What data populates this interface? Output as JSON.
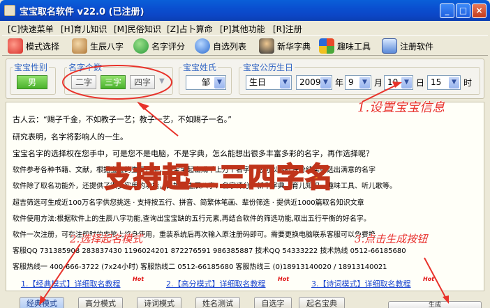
{
  "window": {
    "title": "宝宝取名软件 v22.0 (已注册)",
    "btn_min": "_",
    "btn_max": "□",
    "btn_close": "×"
  },
  "menu": [
    "[C]快速菜单",
    "[H]育儿知识",
    "[M]民俗知识",
    "[Z]占卜算命",
    "[P]其他功能",
    "[R]注册"
  ],
  "toolbar": [
    {
      "label": "模式选择",
      "icon": "heart-icon",
      "color": "#e8423a"
    },
    {
      "label": "生辰八字",
      "icon": "people-icon",
      "color": "#c89048"
    },
    {
      "label": "名字评分",
      "icon": "arrow-icon",
      "color": "#3aa84a"
    },
    {
      "label": "自选列表",
      "icon": "globe-icon",
      "color": "#3a7ad8"
    },
    {
      "label": "新华字典",
      "icon": "scholar-icon",
      "color": "#3a3a3a"
    },
    {
      "label": "趣味工具",
      "icon": "windows-icon",
      "color": "#e8a020"
    },
    {
      "label": "注册软件",
      "icon": "monitor-icon",
      "color": "#5a8ad8"
    }
  ],
  "options": {
    "gender_label": "宝宝性别",
    "gender_value": "男",
    "count_label": "名字个数",
    "count_options": [
      "二字",
      "三字",
      "四字"
    ],
    "count_selected": "三字",
    "surname_label": "宝宝姓氏",
    "surname_value": "邹",
    "birth_label": "宝宝公历生日",
    "calendar_value": "生日",
    "year_value": "2009",
    "year_unit": "年",
    "month_value": "9",
    "month_unit": "月",
    "day_value": "10",
    "day_unit": "日",
    "hour_value": "15",
    "hour_unit": "时"
  },
  "content": {
    "lines": [
      "古人云：“赐子千金，不如教子一艺；教子一艺，不如赐子一名。”",
      "研究表明，名字将影响人的一生。",
      "宝宝名字的选择权在您手中，可是您不是电脑，不是字典，怎么能想出很多丰富多彩的名字，再作选择呢？",
      "软件参考各种书籍、文献，根据宝宝的生辰八字，为宝宝起出成千上万个名字，您可以根据评分结果筛选出满意的名字",
      "软件除了取名功能外，还提供了很多实用的功能，比如：生辰八字、名字评分、新华字典、育儿知识、趣味工具、听儿歌等。",
      "超吉筛选可生成近100万名字供您挑选 · 支持按五行、拼音、简繁体笔画、辈份筛选 · 提供近1000篇取名知识文章",
      "软件使用方法:根据软件上的生辰八字功能,查询出宝宝缺的五行元素,再结合软件的筛选功能,取出五行平衡的好名字。",
      "软件一次注册，可在注册时的电脑上终身使用，重装系统后再次输入原注册码即可。需要更换电脑联系客服可以免费换",
      "客服QQ 731385908  283837430  1196024201  872276591  986385887  技术QQ 54333222  技术热线 0512-66185680",
      "客服热线一 400-666-3722 (7x24小时)  客服热线二 0512-66185680  客服热线三 (0)18913140020 / 18913140021"
    ],
    "links": [
      "1.【经典模式】详细取名教程",
      "2.【高分模式】详细取名教程",
      "3.【诗词模式】详细取名教程"
    ],
    "hot": "Hot"
  },
  "tabs": [
    "经典模式",
    "高分模式",
    "诗词模式",
    "姓名测试",
    "自选字",
    "起名宝典"
  ],
  "generate_button": "生成",
  "annotations": {
    "step1": "1.设置宝宝信息",
    "step2": "2.选择起名模式",
    "step3": "3.点击生成按钮",
    "headline": "支持起二三四字名"
  },
  "colors": {
    "accent_red": "#e8322a",
    "headline_orange": "#f08a1c",
    "link_blue": "#1a45d0",
    "selected_green": "#4ab22c"
  }
}
